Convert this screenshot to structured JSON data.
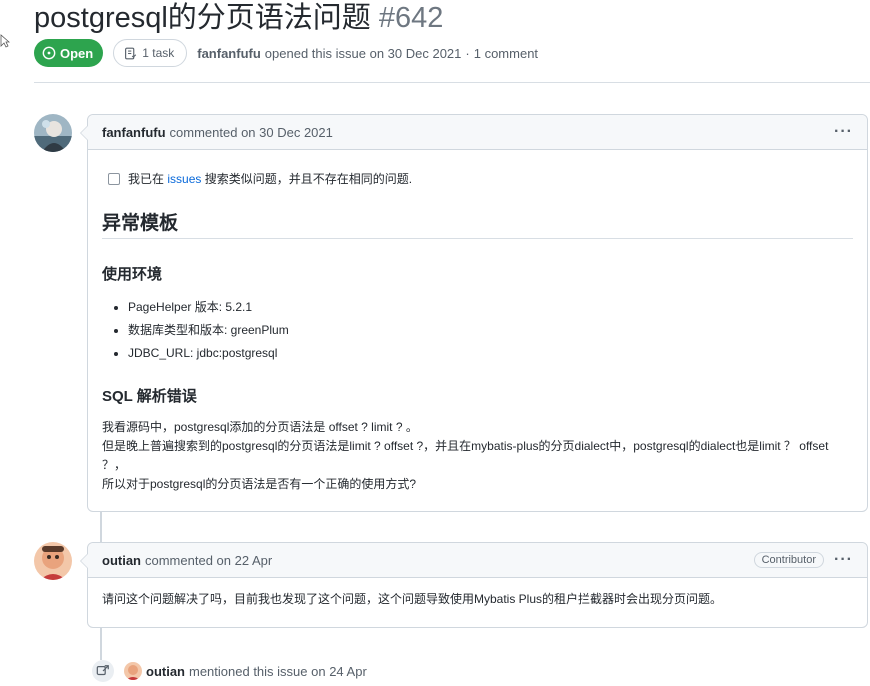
{
  "issue": {
    "title": "postgresql的分页语法问题",
    "number": "#642",
    "status": "Open",
    "tasks": "1 task",
    "author": "fanfanfufu",
    "opened_text": "opened this issue on 30 Dec 2021",
    "separator": "·",
    "comments_count": "1 comment"
  },
  "comments": [
    {
      "author": "fanfanfufu",
      "action": "commented on 30 Dec 2021",
      "more": "···",
      "checkbox_pre": "我已在",
      "checkbox_link": "issues",
      "checkbox_post": "搜索类似问题，并且不存在相同的问题.",
      "heading": "异常模板",
      "env_heading": "使用环境",
      "env_items": [
        "PageHelper 版本: 5.2.1",
        "数据库类型和版本: greenPlum",
        "JDBC_URL: jdbc:postgresql"
      ],
      "sql_heading": "SQL 解析错误",
      "paragraphs": [
        "我看源码中，postgresql添加的分页语法是 offset ? limit ? 。",
        "但是晚上普遍搜索到的postgresql的分页语法是limit ? offset ?，并且在mybatis-plus的分页dialect中，postgresql的dialect也是limit ？ offset ？，",
        "所以对于postgresql的分页语法是否有一个正确的使用方式?"
      ]
    },
    {
      "author": "outian",
      "action": "commented on 22 Apr",
      "badge": "Contributor",
      "more": "···",
      "body": "请问这个问题解决了吗，目前我也发现了这个问题，这个问题导致使用Mybatis Plus的租户拦截器时会出现分页问题。"
    }
  ],
  "mention": {
    "user": "outian",
    "text": "mentioned this issue on 24 Apr"
  },
  "colors": {
    "open_green": "#2da44e",
    "link_blue": "#0969da",
    "border": "#d0d7de",
    "muted": "#57606a"
  },
  "icons": [
    "issue-opened-icon",
    "tasklist-icon",
    "kebab-horizontal-icon",
    "cross-reference-icon"
  ]
}
